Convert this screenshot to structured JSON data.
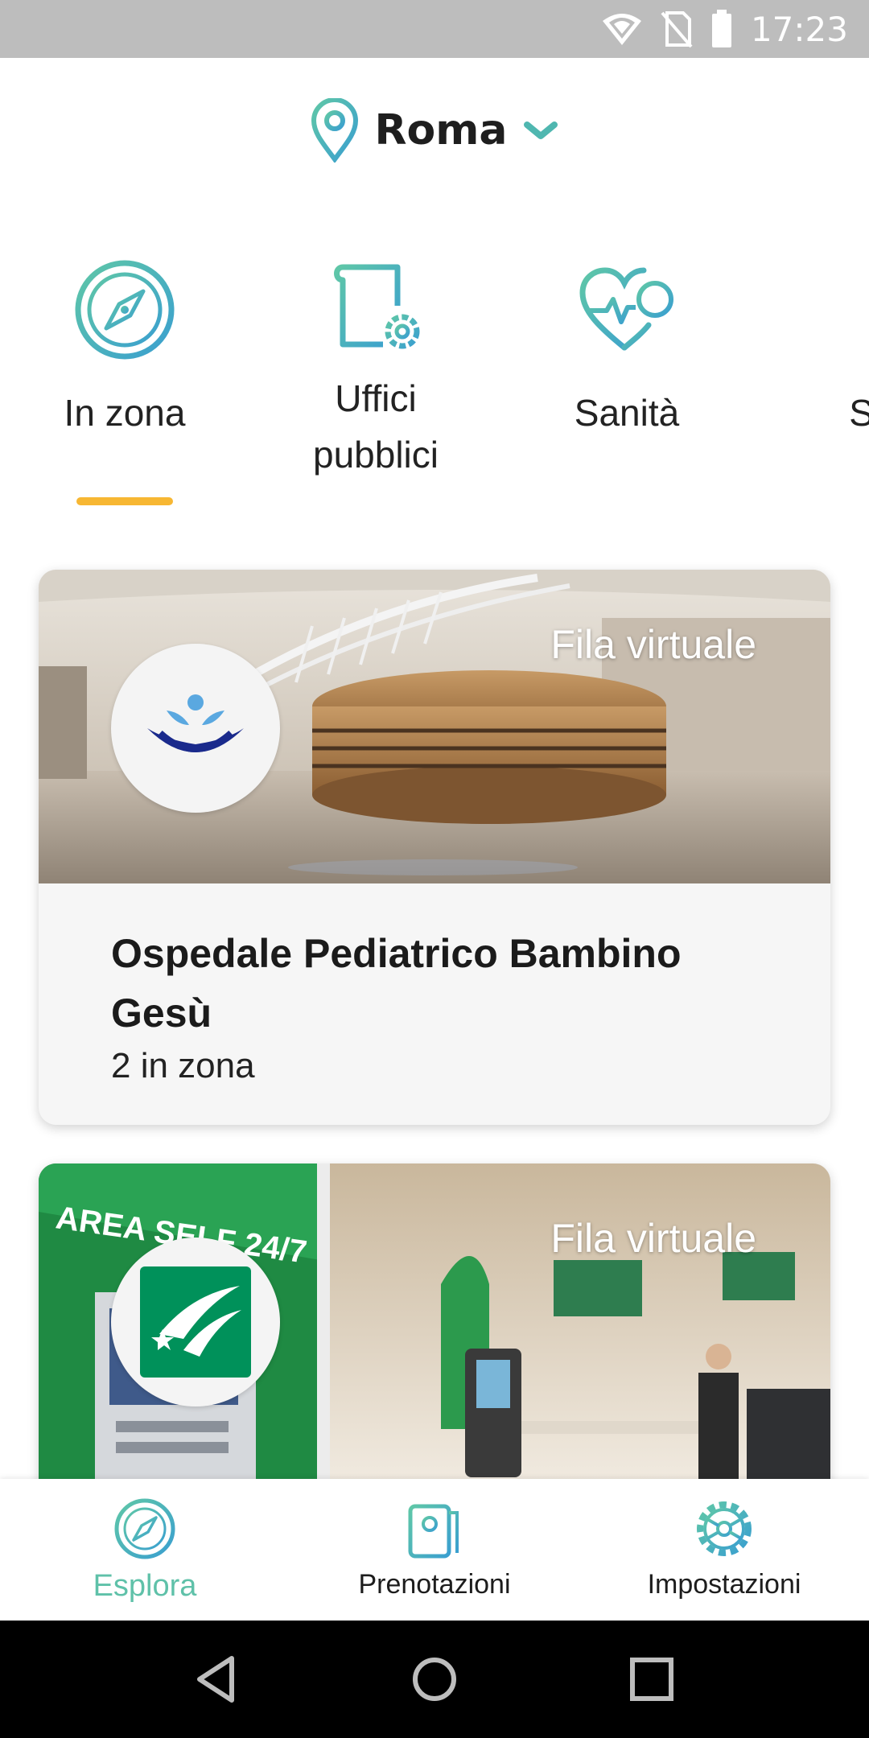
{
  "status_bar": {
    "time": "17:23"
  },
  "location": {
    "city": "Roma"
  },
  "categories": [
    {
      "label": "In zona",
      "icon": "compass-icon",
      "active": true
    },
    {
      "label": "Uffici\npubblici",
      "icon": "document-gear-icon",
      "active": false
    },
    {
      "label": "Sanità",
      "icon": "heart-plus-icon",
      "active": false
    },
    {
      "label": "Ser",
      "icon": "services-icon",
      "active": false
    }
  ],
  "cards": [
    {
      "badge": "Fila virtuale",
      "title": "Ospedale Pediatrico Bambino Gesù",
      "subtitle": "2 in zona",
      "logo": "bambino-gesu-logo"
    },
    {
      "badge": "Fila virtuale",
      "title": "",
      "subtitle": "",
      "logo": "bnl-logo"
    }
  ],
  "bottom_nav": [
    {
      "label": "Esplora",
      "icon": "compass-icon",
      "active": true
    },
    {
      "label": "Prenotazioni",
      "icon": "ticket-icon",
      "active": false
    },
    {
      "label": "Impostazioni",
      "icon": "gear-icon",
      "active": false
    }
  ],
  "colors": {
    "accent_teal": "#5fc1a9",
    "accent_blue": "#3b9fd1",
    "underline_yellow": "#f7b733",
    "status_bar": "#bdbdbd"
  }
}
